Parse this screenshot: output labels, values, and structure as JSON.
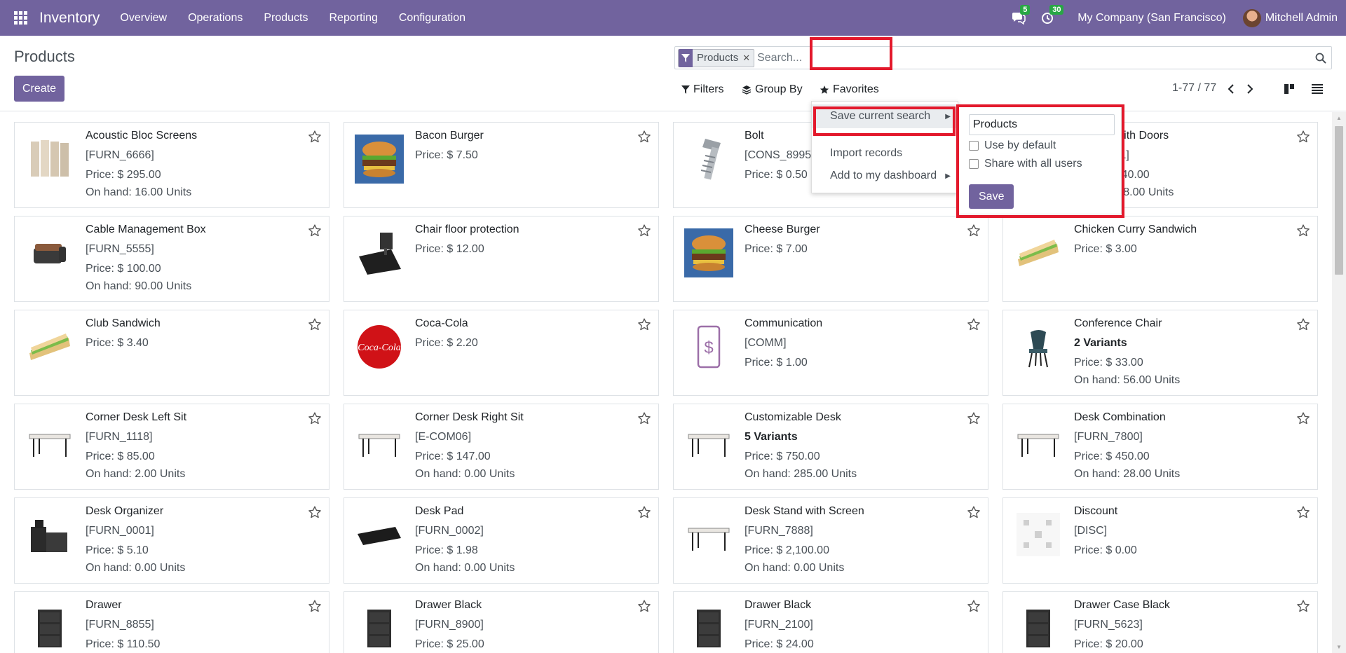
{
  "navbar": {
    "app_name": "Inventory",
    "menus": [
      "Overview",
      "Operations",
      "Products",
      "Reporting",
      "Configuration"
    ],
    "messages_count": "5",
    "activities_count": "30",
    "company": "My Company (San Francisco)",
    "user": "Mitchell Admin",
    "bar_color": "#71639e"
  },
  "control_panel": {
    "title": "Products",
    "create_label": "Create",
    "search": {
      "facet_value": "Products",
      "placeholder": "Search..."
    },
    "filters_label": "Filters",
    "groupby_label": "Group By",
    "favorites_label": "Favorites",
    "pager": "1-77 / 77"
  },
  "favorites_menu": {
    "save_current_search": "Save current search",
    "import_records": "Import records",
    "add_to_dashboard": "Add to my dashboard",
    "save_panel": {
      "name_value": "Products",
      "use_by_default": "Use by default",
      "share_with_all": "Share with all users",
      "save_label": "Save"
    }
  },
  "highlight_color": "#e3192c",
  "products": [
    {
      "name": "Acoustic Bloc Screens",
      "ref": "[FURN_6666]",
      "price": "Price: $ 295.00",
      "onhand": "On hand: 16.00 Units",
      "icon": "screens-image"
    },
    {
      "name": "Bacon Burger",
      "price": "Price: $ 7.50",
      "icon": "burger-image"
    },
    {
      "name": "Bolt",
      "ref": "[CONS_89957]",
      "price": "Price: $ 0.50",
      "icon": "bolt-image"
    },
    {
      "name": "Cabinet with Doors",
      "ref": "[E-COM11]",
      "price": "Price: $ 140.00",
      "onhand": "On hand: 8.00 Units",
      "icon": "cabinet-image"
    },
    {
      "name": "Cable Management Box",
      "ref": "[FURN_5555]",
      "price": "Price: $ 100.00",
      "onhand": "On hand: 90.00 Units",
      "icon": "box-image"
    },
    {
      "name": "Chair floor protection",
      "price": "Price: $ 12.00",
      "icon": "floor-mat-image"
    },
    {
      "name": "Cheese Burger",
      "price": "Price: $ 7.00",
      "icon": "burger-image"
    },
    {
      "name": "Chicken Curry Sandwich",
      "price": "Price: $ 3.00",
      "icon": "sandwich-image"
    },
    {
      "name": "Club Sandwich",
      "price": "Price: $ 3.40",
      "icon": "sandwich-image"
    },
    {
      "name": "Coca-Cola",
      "price": "Price: $ 2.20",
      "icon": "coca-cola-image"
    },
    {
      "name": "Communication",
      "ref": "[COMM]",
      "price": "Price: $ 1.00",
      "icon": "phone-dollar-image"
    },
    {
      "name": "Conference Chair",
      "variants": "2 Variants",
      "price": "Price: $ 33.00",
      "onhand": "On hand: 56.00 Units",
      "icon": "chair-image"
    },
    {
      "name": "Corner Desk Left Sit",
      "ref": "[FURN_1118]",
      "price": "Price: $ 85.00",
      "onhand": "On hand: 2.00 Units",
      "icon": "desk-image"
    },
    {
      "name": "Corner Desk Right Sit",
      "ref": "[E-COM06]",
      "price": "Price: $ 147.00",
      "onhand": "On hand: 0.00 Units",
      "icon": "desk-image"
    },
    {
      "name": "Customizable Desk",
      "variants": "5 Variants",
      "price": "Price: $ 750.00",
      "onhand": "On hand: 285.00 Units",
      "icon": "desk-image"
    },
    {
      "name": "Desk Combination",
      "ref": "[FURN_7800]",
      "price": "Price: $ 450.00",
      "onhand": "On hand: 28.00 Units",
      "icon": "desk-image"
    },
    {
      "name": "Desk Organizer",
      "ref": "[FURN_0001]",
      "price": "Price: $ 5.10",
      "onhand": "On hand: 0.00 Units",
      "icon": "organizer-image"
    },
    {
      "name": "Desk Pad",
      "ref": "[FURN_0002]",
      "price": "Price: $ 1.98",
      "onhand": "On hand: 0.00 Units",
      "icon": "desk-pad-image"
    },
    {
      "name": "Desk Stand with Screen",
      "ref": "[FURN_7888]",
      "price": "Price: $ 2,100.00",
      "onhand": "On hand: 0.00 Units",
      "icon": "desk-image"
    },
    {
      "name": "Discount",
      "ref": "[DISC]",
      "price": "Price: $ 0.00",
      "icon": "discount-image"
    },
    {
      "name": "Drawer",
      "ref": "[FURN_8855]",
      "price": "Price: $ 110.50",
      "icon": "drawer-image"
    },
    {
      "name": "Drawer Black",
      "ref": "[FURN_8900]",
      "price": "Price: $ 25.00",
      "icon": "drawer-image"
    },
    {
      "name": "Drawer Black",
      "ref": "[FURN_2100]",
      "price": "Price: $ 24.00",
      "icon": "drawer-image"
    },
    {
      "name": "Drawer Case Black",
      "ref": "[FURN_5623]",
      "price": "Price: $ 20.00",
      "icon": "drawer-image"
    }
  ]
}
